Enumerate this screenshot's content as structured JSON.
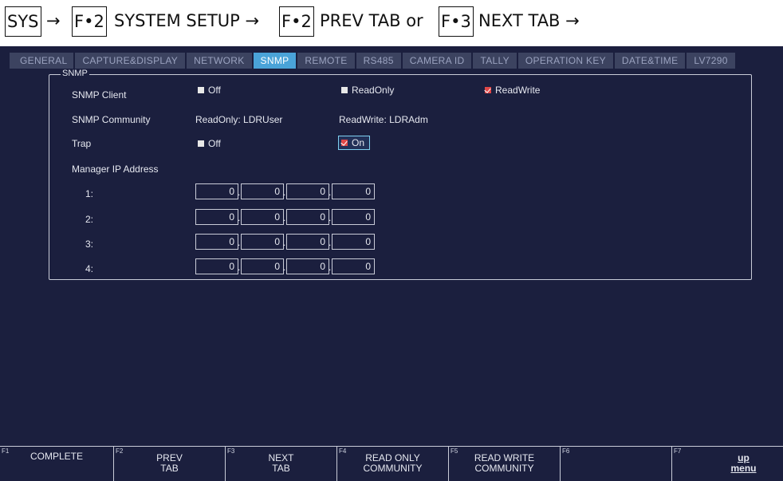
{
  "header": {
    "sys": "SYS",
    "arrow": "→",
    "f2_key": "F•2",
    "system_setup": "SYSTEM SETUP →",
    "f2_key_b": "F•2",
    "prev_tab": "PREV TAB or",
    "f3_key": "F•3",
    "next_tab": "NEXT TAB →"
  },
  "tabs": [
    {
      "label": "GENERAL"
    },
    {
      "label": "CAPTURE&DISPLAY"
    },
    {
      "label": "NETWORK"
    },
    {
      "label": "SNMP",
      "active": true
    },
    {
      "label": "REMOTE"
    },
    {
      "label": "RS485"
    },
    {
      "label": "CAMERA ID"
    },
    {
      "label": "TALLY"
    },
    {
      "label": "OPERATION KEY"
    },
    {
      "label": "DATE&TIME"
    },
    {
      "label": "LV7290"
    }
  ],
  "snmp": {
    "group_title": "SNMP",
    "client_label": "SNMP Client",
    "client_options": [
      {
        "label": "Off",
        "checked": false
      },
      {
        "label": "ReadOnly",
        "checked": false
      },
      {
        "label": "ReadWrite",
        "checked": true
      }
    ],
    "community_label": "SNMP Community",
    "community_readonly": "ReadOnly: LDRUser",
    "community_readwrite": "ReadWrite: LDRAdm",
    "trap_label": "Trap",
    "trap_options": [
      {
        "label": "Off",
        "checked": false
      },
      {
        "label": "On",
        "checked": true
      }
    ],
    "manager_label": "Manager IP Address",
    "managers": [
      {
        "index": "1:",
        "octets": [
          "0",
          "0",
          "0",
          "0"
        ]
      },
      {
        "index": "2:",
        "octets": [
          "0",
          "0",
          "0",
          "0"
        ]
      },
      {
        "index": "3:",
        "octets": [
          "0",
          "0",
          "0",
          "0"
        ]
      },
      {
        "index": "4:",
        "octets": [
          "0",
          "0",
          "0",
          "0"
        ]
      }
    ]
  },
  "fkeys": [
    {
      "num": "F1",
      "label": "COMPLETE"
    },
    {
      "num": "F2",
      "label": "PREV\nTAB"
    },
    {
      "num": "F3",
      "label": "NEXT\nTAB"
    },
    {
      "num": "F4",
      "label": "READ ONLY\nCOMMUNITY"
    },
    {
      "num": "F5",
      "label": "READ WRITE\nCOMMUNITY"
    },
    {
      "num": "F6",
      "label": ""
    },
    {
      "num": "F7",
      "label": "up\nmenu"
    }
  ],
  "colors": {
    "background": "#1b1f3e",
    "tab": "#3c4360",
    "tab_active": "#4aa3d8",
    "checkbox_checked": "#e04848"
  }
}
